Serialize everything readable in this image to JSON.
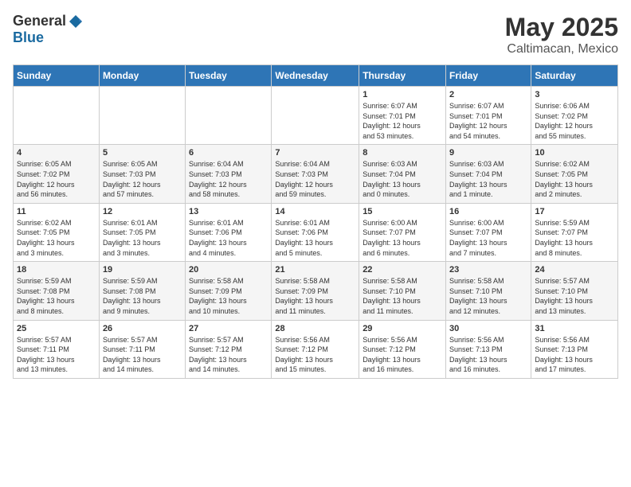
{
  "header": {
    "logo_general": "General",
    "logo_blue": "Blue",
    "month_title": "May 2025",
    "location": "Caltimacan, Mexico"
  },
  "days_of_week": [
    "Sunday",
    "Monday",
    "Tuesday",
    "Wednesday",
    "Thursday",
    "Friday",
    "Saturday"
  ],
  "weeks": [
    [
      {
        "day": "",
        "info": ""
      },
      {
        "day": "",
        "info": ""
      },
      {
        "day": "",
        "info": ""
      },
      {
        "day": "",
        "info": ""
      },
      {
        "day": "1",
        "info": "Sunrise: 6:07 AM\nSunset: 7:01 PM\nDaylight: 12 hours\nand 53 minutes."
      },
      {
        "day": "2",
        "info": "Sunrise: 6:07 AM\nSunset: 7:01 PM\nDaylight: 12 hours\nand 54 minutes."
      },
      {
        "day": "3",
        "info": "Sunrise: 6:06 AM\nSunset: 7:02 PM\nDaylight: 12 hours\nand 55 minutes."
      }
    ],
    [
      {
        "day": "4",
        "info": "Sunrise: 6:05 AM\nSunset: 7:02 PM\nDaylight: 12 hours\nand 56 minutes."
      },
      {
        "day": "5",
        "info": "Sunrise: 6:05 AM\nSunset: 7:03 PM\nDaylight: 12 hours\nand 57 minutes."
      },
      {
        "day": "6",
        "info": "Sunrise: 6:04 AM\nSunset: 7:03 PM\nDaylight: 12 hours\nand 58 minutes."
      },
      {
        "day": "7",
        "info": "Sunrise: 6:04 AM\nSunset: 7:03 PM\nDaylight: 12 hours\nand 59 minutes."
      },
      {
        "day": "8",
        "info": "Sunrise: 6:03 AM\nSunset: 7:04 PM\nDaylight: 13 hours\nand 0 minutes."
      },
      {
        "day": "9",
        "info": "Sunrise: 6:03 AM\nSunset: 7:04 PM\nDaylight: 13 hours\nand 1 minute."
      },
      {
        "day": "10",
        "info": "Sunrise: 6:02 AM\nSunset: 7:05 PM\nDaylight: 13 hours\nand 2 minutes."
      }
    ],
    [
      {
        "day": "11",
        "info": "Sunrise: 6:02 AM\nSunset: 7:05 PM\nDaylight: 13 hours\nand 3 minutes."
      },
      {
        "day": "12",
        "info": "Sunrise: 6:01 AM\nSunset: 7:05 PM\nDaylight: 13 hours\nand 3 minutes."
      },
      {
        "day": "13",
        "info": "Sunrise: 6:01 AM\nSunset: 7:06 PM\nDaylight: 13 hours\nand 4 minutes."
      },
      {
        "day": "14",
        "info": "Sunrise: 6:01 AM\nSunset: 7:06 PM\nDaylight: 13 hours\nand 5 minutes."
      },
      {
        "day": "15",
        "info": "Sunrise: 6:00 AM\nSunset: 7:07 PM\nDaylight: 13 hours\nand 6 minutes."
      },
      {
        "day": "16",
        "info": "Sunrise: 6:00 AM\nSunset: 7:07 PM\nDaylight: 13 hours\nand 7 minutes."
      },
      {
        "day": "17",
        "info": "Sunrise: 5:59 AM\nSunset: 7:07 PM\nDaylight: 13 hours\nand 8 minutes."
      }
    ],
    [
      {
        "day": "18",
        "info": "Sunrise: 5:59 AM\nSunset: 7:08 PM\nDaylight: 13 hours\nand 8 minutes."
      },
      {
        "day": "19",
        "info": "Sunrise: 5:59 AM\nSunset: 7:08 PM\nDaylight: 13 hours\nand 9 minutes."
      },
      {
        "day": "20",
        "info": "Sunrise: 5:58 AM\nSunset: 7:09 PM\nDaylight: 13 hours\nand 10 minutes."
      },
      {
        "day": "21",
        "info": "Sunrise: 5:58 AM\nSunset: 7:09 PM\nDaylight: 13 hours\nand 11 minutes."
      },
      {
        "day": "22",
        "info": "Sunrise: 5:58 AM\nSunset: 7:10 PM\nDaylight: 13 hours\nand 11 minutes."
      },
      {
        "day": "23",
        "info": "Sunrise: 5:58 AM\nSunset: 7:10 PM\nDaylight: 13 hours\nand 12 minutes."
      },
      {
        "day": "24",
        "info": "Sunrise: 5:57 AM\nSunset: 7:10 PM\nDaylight: 13 hours\nand 13 minutes."
      }
    ],
    [
      {
        "day": "25",
        "info": "Sunrise: 5:57 AM\nSunset: 7:11 PM\nDaylight: 13 hours\nand 13 minutes."
      },
      {
        "day": "26",
        "info": "Sunrise: 5:57 AM\nSunset: 7:11 PM\nDaylight: 13 hours\nand 14 minutes."
      },
      {
        "day": "27",
        "info": "Sunrise: 5:57 AM\nSunset: 7:12 PM\nDaylight: 13 hours\nand 14 minutes."
      },
      {
        "day": "28",
        "info": "Sunrise: 5:56 AM\nSunset: 7:12 PM\nDaylight: 13 hours\nand 15 minutes."
      },
      {
        "day": "29",
        "info": "Sunrise: 5:56 AM\nSunset: 7:12 PM\nDaylight: 13 hours\nand 16 minutes."
      },
      {
        "day": "30",
        "info": "Sunrise: 5:56 AM\nSunset: 7:13 PM\nDaylight: 13 hours\nand 16 minutes."
      },
      {
        "day": "31",
        "info": "Sunrise: 5:56 AM\nSunset: 7:13 PM\nDaylight: 13 hours\nand 17 minutes."
      }
    ]
  ]
}
